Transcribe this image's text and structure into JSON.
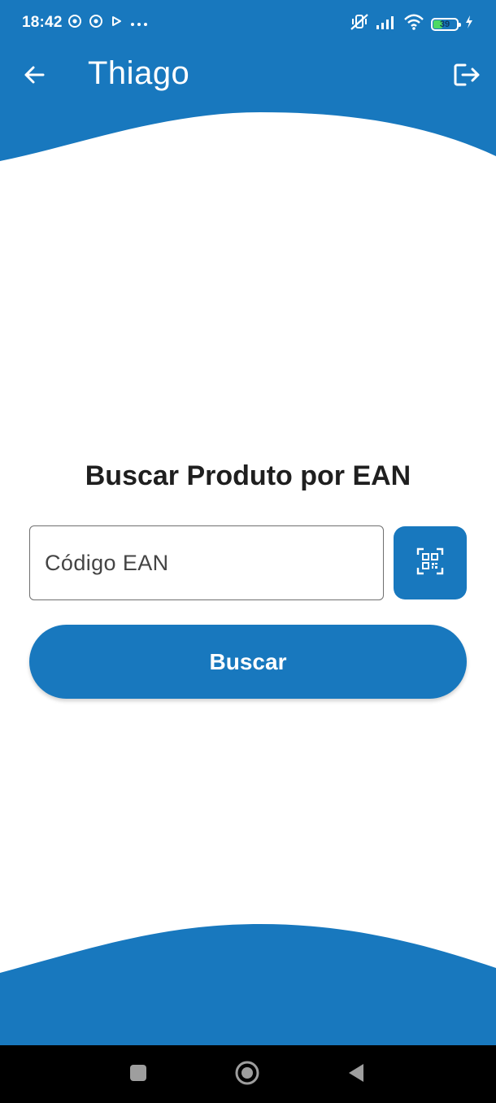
{
  "colors": {
    "primary": "#1878be",
    "background": "#ffffff",
    "title_text": "#1f1f1f",
    "nav_bar": "#000000"
  },
  "status_bar": {
    "time": "18:42",
    "battery_level": "39",
    "battery_fraction": 0.39,
    "left_icons": [
      "chrome-icon",
      "chrome-icon",
      "play-icon",
      "more-dots-icon"
    ],
    "right_icons": [
      "mute-vibrate-icon",
      "signal-icon",
      "wifi-icon",
      "battery-icon",
      "charging-icon"
    ]
  },
  "app_bar": {
    "title": "Thiago",
    "back_icon": "arrow-back-icon",
    "logout_icon": "logout-icon"
  },
  "main": {
    "title": "Buscar Produto por EAN",
    "ean_field": {
      "placeholder": "Código EAN",
      "value": ""
    },
    "scan_icon": "qr-scan-icon",
    "search_button_label": "Buscar"
  },
  "nav_bar": {
    "buttons": [
      "recents-square-icon",
      "home-circle-icon",
      "back-triangle-icon"
    ]
  }
}
